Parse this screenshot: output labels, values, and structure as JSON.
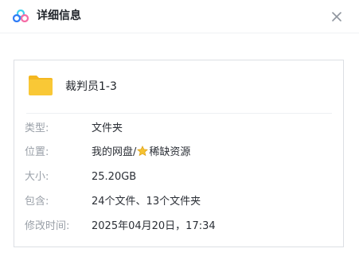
{
  "dialog": {
    "title": "详细信息",
    "icons": {
      "logo": "baidu-netdisk-logo-icon",
      "close": "close-icon",
      "folder": "folder-icon",
      "star": "star-emoji-icon"
    }
  },
  "file": {
    "name": "裁判员1-3"
  },
  "details": {
    "type": {
      "label": "类型:",
      "value": "文件夹"
    },
    "location": {
      "label": "位置:",
      "prefix": "我的网盘/",
      "suffix": "稀缺资源"
    },
    "size": {
      "label": "大小:",
      "value": "25.20GB"
    },
    "contains": {
      "label": "包含:",
      "value": "24个文件、13个文件夹"
    },
    "modified": {
      "label": "修改时间:",
      "value": "2025年04月20日，17:34"
    }
  },
  "colors": {
    "folder": "#f9c836",
    "logo_blue": "#2f7cf6",
    "logo_cyan": "#3fd0f0",
    "logo_pink": "#f56ca5",
    "star": "#f6c230"
  }
}
